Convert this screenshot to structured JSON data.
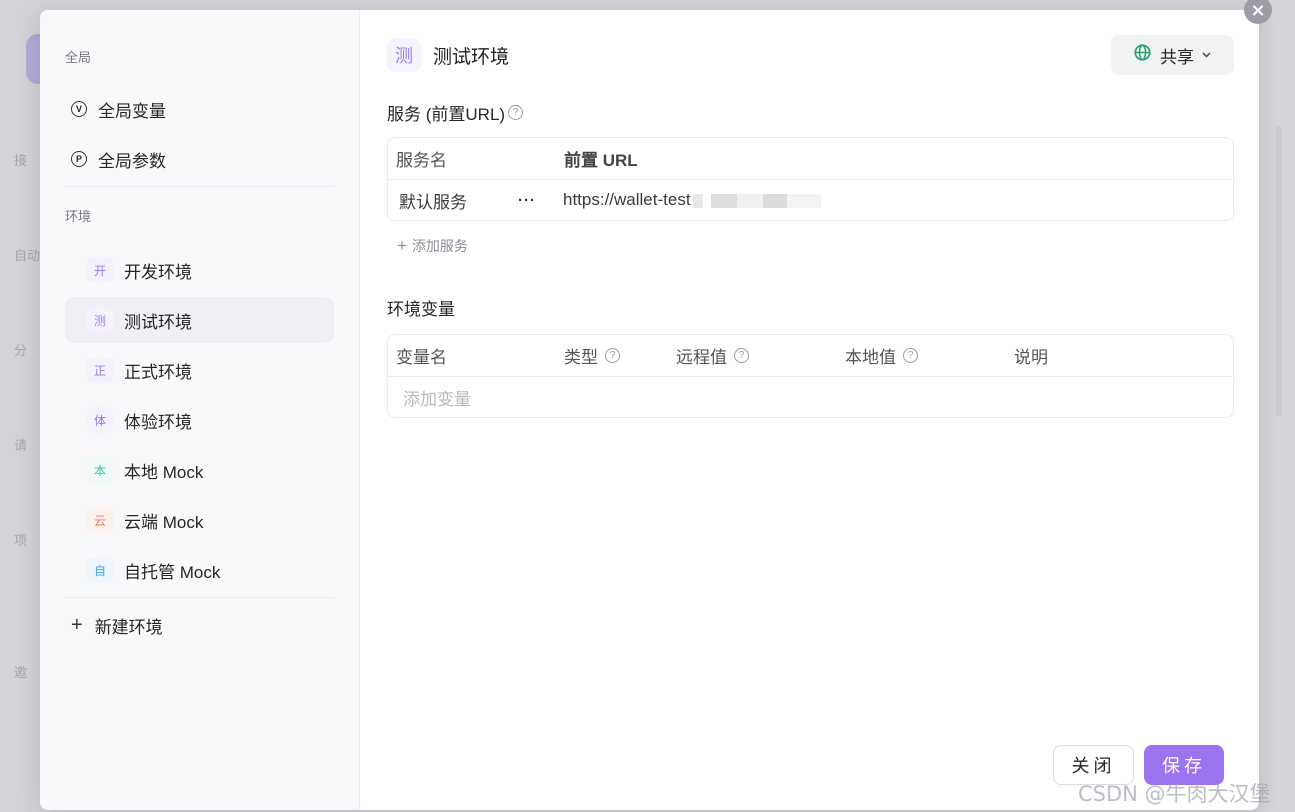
{
  "background": {
    "side_items": [
      "接",
      "自动",
      "分",
      "请",
      "项",
      "邀"
    ]
  },
  "left_panel": {
    "global_label": "全局",
    "global_items": [
      {
        "label": "全局变量",
        "icon_text": "V"
      },
      {
        "label": "全局参数",
        "icon_text": "P"
      }
    ],
    "env_label": "环境",
    "environments": [
      {
        "badge": "开",
        "label": "开发环境",
        "badge_bg": "#f4f2fd",
        "badge_color": "#8f7ee6"
      },
      {
        "badge": "测",
        "label": "测试环境",
        "badge_bg": "#f6f3fe",
        "badge_color": "#9a7ff0"
      },
      {
        "badge": "正",
        "label": "正式环境",
        "badge_bg": "#f4f2fd",
        "badge_color": "#8f7ee6"
      },
      {
        "badge": "体",
        "label": "体验环境",
        "badge_bg": "#f4f2fd",
        "badge_color": "#8f7ee6"
      },
      {
        "badge": "本",
        "label": "本地 Mock",
        "badge_bg": "#eefaf8",
        "badge_color": "#3bbfa8"
      },
      {
        "badge": "云",
        "label": "云端 Mock",
        "badge_bg": "#fdf1ee",
        "badge_color": "#ec7d5c"
      },
      {
        "badge": "自",
        "label": "自托管 Mock",
        "badge_bg": "#edf6fd",
        "badge_color": "#4aa3e6"
      }
    ],
    "new_env_label": "新建环境"
  },
  "main": {
    "title_badge": "测",
    "title": "测试环境",
    "share_label": "共享",
    "services_title": "服务 (前置URL)",
    "services_help": "?",
    "services_columns": [
      "服务名",
      "前置 URL"
    ],
    "services_rows": [
      {
        "name": "默认服务",
        "more": "···",
        "url": "https://wallet-test"
      }
    ],
    "add_service_label": "添加服务",
    "vars_title": "环境变量",
    "vars_columns": [
      "变量名",
      "类型",
      "远程值",
      "本地值",
      "说明"
    ],
    "vars_placeholder": "添加变量",
    "close_button": "关闭",
    "save_button": "保存"
  },
  "watermark": "CSDN @牛肉大汉堡",
  "colors": {
    "accent": "#9b74ef",
    "active_bg": "#efeff4",
    "globe_green": "#21a366"
  }
}
